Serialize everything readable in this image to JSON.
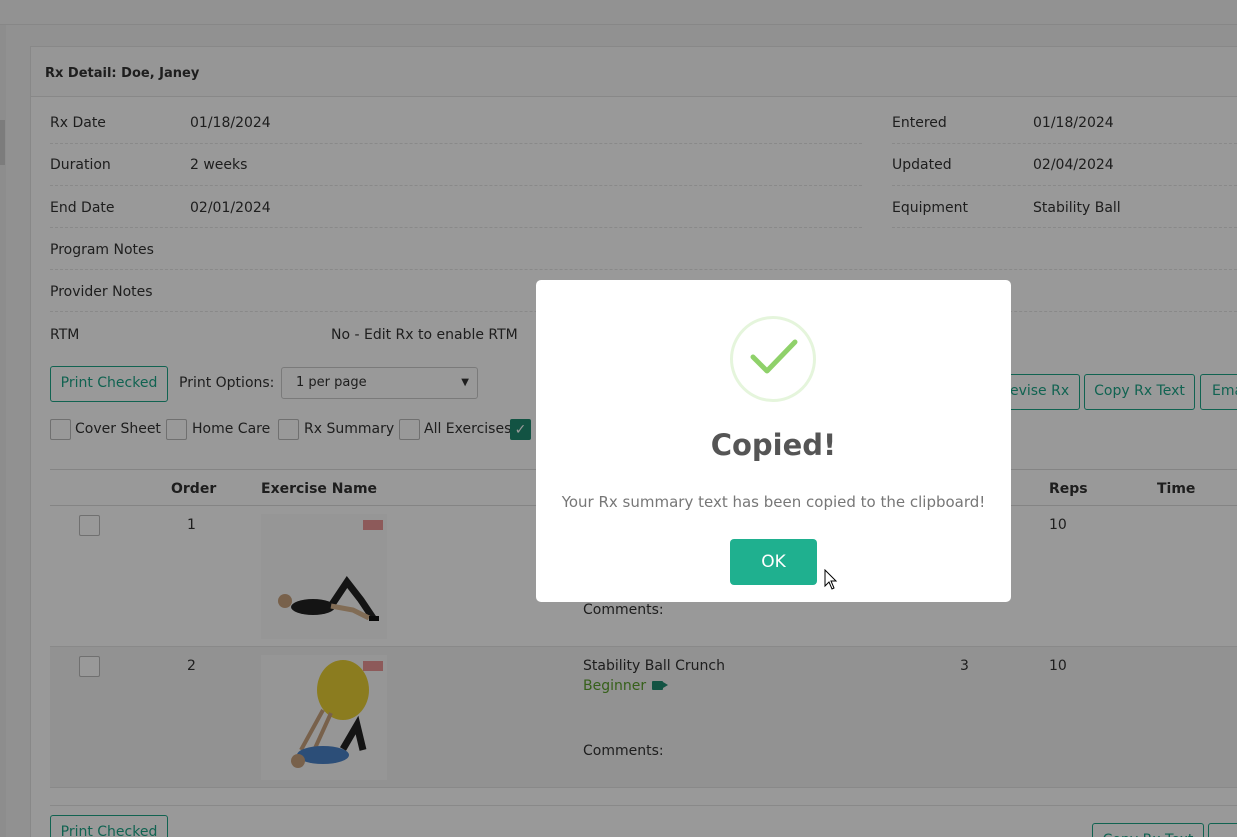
{
  "panel": {
    "title": "Rx Detail: Doe, Janey"
  },
  "details": {
    "rx_date_label": "Rx Date",
    "rx_date": "01/18/2024",
    "duration_label": "Duration",
    "duration": "2 weeks",
    "end_date_label": "End Date",
    "end_date": "02/01/2024",
    "entered_label": "Entered",
    "entered": "01/18/2024",
    "updated_label": "Updated",
    "updated": "02/04/2024",
    "equipment_label": "Equipment",
    "equipment": "Stability Ball",
    "program_notes_label": "Program Notes",
    "provider_notes_label": "Provider Notes",
    "rtm_label": "RTM",
    "rtm": "No - Edit Rx to enable RTM"
  },
  "toolbar": {
    "print_checked": "Print Checked",
    "print_options_label": "Print Options:",
    "print_options_value": "1 per page",
    "revise_rx": "Revise Rx",
    "copy_rx_text": "Copy Rx Text",
    "email": "Ema"
  },
  "print_checkboxes": [
    {
      "label": "Cover Sheet",
      "checked": false
    },
    {
      "label": "Home Care",
      "checked": false
    },
    {
      "label": "Rx Summary",
      "checked": false
    },
    {
      "label": "All Exercises",
      "checked": true
    }
  ],
  "table": {
    "headers": {
      "order": "Order",
      "name": "Exercise Name",
      "reps": "Reps",
      "time": "Time"
    },
    "rows": [
      {
        "order": "1",
        "name": "",
        "level": "",
        "sets": "",
        "reps": "10",
        "comments": "Comments:"
      },
      {
        "order": "2",
        "name": "Stability Ball Crunch",
        "level": "Beginner",
        "sets": "3",
        "reps": "10",
        "comments": "Comments:"
      }
    ]
  },
  "bottom": {
    "print_checked": "Print Checked",
    "copy_rx_text": "Copy Rx Text"
  },
  "modal": {
    "title": "Copied!",
    "message": "Your Rx summary text has been copied to the clipboard!",
    "ok": "OK"
  },
  "colors": {
    "accent": "#1da588",
    "ok_button": "#1fb08f",
    "level": "#5aa02c",
    "check": "#8fd16a"
  }
}
